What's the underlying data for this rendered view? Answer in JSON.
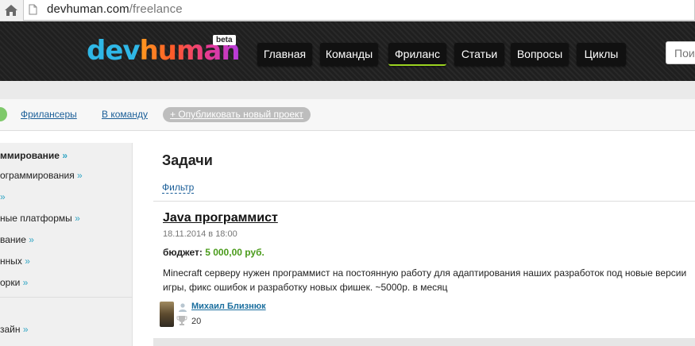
{
  "browser": {
    "url_domain": "devhuman.com",
    "url_path": "/freelance"
  },
  "header": {
    "logo_dev": "dev",
    "logo_human": "human",
    "beta": "beta",
    "nav": [
      {
        "label": "Главная"
      },
      {
        "label": "Команды"
      },
      {
        "label": "Фриланс",
        "active": true
      },
      {
        "label": "Статьи"
      },
      {
        "label": "Вопросы"
      },
      {
        "label": "Циклы"
      }
    ],
    "search_placeholder": "Пои",
    "accent_color": "#9bd321"
  },
  "subnav": {
    "freelancers": "Фрилансеры",
    "to_team": "В команду",
    "publish": "+ Опубликовать новый проект"
  },
  "sidebar": {
    "items": [
      {
        "text": "ммирование",
        "arrow": "»"
      },
      {
        "text": "ограммирования",
        "arrow": "»"
      },
      {
        "text": "",
        "arrow": "»"
      },
      {
        "text": "ные платформы",
        "arrow": "»"
      },
      {
        "text": "вание",
        "arrow": "»"
      },
      {
        "text": "нных",
        "arrow": "»"
      },
      {
        "text": "орки",
        "arrow": "»"
      },
      {
        "text": "зайн",
        "arrow": "»"
      }
    ]
  },
  "main": {
    "title": "Задачи",
    "filter": "Фильтр",
    "task": {
      "title": "Java программист",
      "date": "18.11.2014 в 18:00",
      "budget_label": "бюджет:",
      "budget_value": "5 000,00 руб.",
      "description": "Minecraft серверу нужен программист на постоянную работу для адаптирования наших разработок под новые версии игры, фикс ошибок и разработку новых фишек. ~5000р. в месяц",
      "author": "Михаил Близнюк",
      "score": "20"
    }
  }
}
